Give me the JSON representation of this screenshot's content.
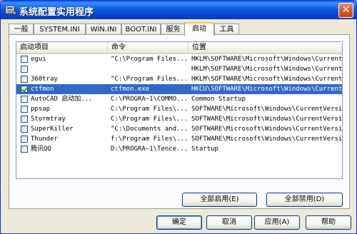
{
  "window": {
    "title": "系统配置实用程序",
    "app_icon": "msconfig-icon",
    "close_icon": "close-icon"
  },
  "tabs": [
    {
      "label": "一般",
      "active": false
    },
    {
      "label": "SYSTEM.INI",
      "active": false
    },
    {
      "label": "WIN.INI",
      "active": false
    },
    {
      "label": "BOOT.INI",
      "active": false
    },
    {
      "label": "服务",
      "active": false
    },
    {
      "label": "启动",
      "active": true
    },
    {
      "label": "工具",
      "active": false
    }
  ],
  "startup_list": {
    "columns": [
      "启动项目",
      "命令",
      "位置"
    ],
    "rows": [
      {
        "item": "egui",
        "command": "\"C:\\Program Files...",
        "location": "HKLM\\SOFTWARE\\Microsoft\\Windows\\Current...",
        "checked": false,
        "selected": false
      },
      {
        "item": "",
        "command": "",
        "location": "HKLM\\SOFTWARE\\Microsoft\\Windows\\Current...",
        "checked": false,
        "selected": false
      },
      {
        "item": "360tray",
        "command": "\"C:\\Program Files...",
        "location": "HKLM\\SOFTWARE\\Microsoft\\Windows\\Current...",
        "checked": false,
        "selected": false
      },
      {
        "item": "ctfmon",
        "command": "ctfmon.exe",
        "location": "HKCU\\SOFTWARE\\Microsoft\\Windows\\Current...",
        "checked": true,
        "selected": true
      },
      {
        "item": "AutoCAD 启动加...",
        "command": "C:\\PROGRA~1\\COMMO...",
        "location": "Common Startup",
        "checked": false,
        "selected": false
      },
      {
        "item": "ppsap",
        "command": "C:\\Program Files\\...",
        "location": "SOFTWARE\\Microsoft\\Windows\\CurrentVersi...",
        "checked": false,
        "selected": false
      },
      {
        "item": "Stormtray",
        "command": "C:\\Program Files\\...",
        "location": "SOFTWARE\\Microsoft\\Windows\\CurrentVersi...",
        "checked": false,
        "selected": false
      },
      {
        "item": "SuperKiller",
        "command": "\"C:\\Documents and...",
        "location": "SOFTWARE\\Microsoft\\Windows\\CurrentVersi...",
        "checked": false,
        "selected": false
      },
      {
        "item": "Thunder",
        "command": "f:\\Program Files\\...",
        "location": "SOFTWARE\\Microsoft\\Windows\\CurrentVersi...",
        "checked": false,
        "selected": false
      },
      {
        "item": "腾讯QQ",
        "command": "D:\\PROGRA~1\\Tence...",
        "location": "Startup",
        "checked": false,
        "selected": false
      }
    ]
  },
  "panel_buttons": {
    "enable_all": "全部启用(E)",
    "disable_all": "全部禁用(D)"
  },
  "dialog_buttons": {
    "ok": "确定",
    "cancel": "取消",
    "apply": "应用(A)",
    "help": "帮助"
  },
  "colors": {
    "title_bar": "#0542c9",
    "selection": "#316ac5",
    "dialog_face": "#ece9d8"
  }
}
